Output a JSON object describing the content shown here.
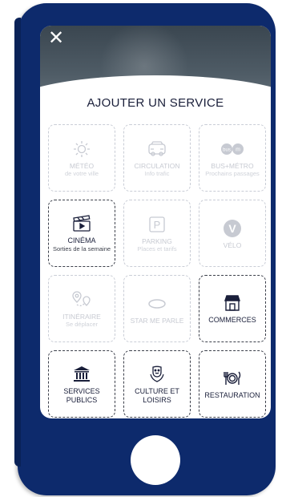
{
  "header": {
    "close_glyph": "✕",
    "title": "AJOUTER UN SERVICE"
  },
  "colors": {
    "phone_frame": "#0d2a6c",
    "active_text": "#1a1f3a",
    "disabled_text": "#c7cad2"
  },
  "services": [
    {
      "label": "MÉTÉO",
      "sub": "de votre ville",
      "icon": "sun-icon",
      "enabled": false
    },
    {
      "label": "CIRCULATION",
      "sub": "Info trafic",
      "icon": "car-icon",
      "enabled": false
    },
    {
      "label": "BUS+MÉTRO",
      "sub": "Prochains passages",
      "icon": "bus-metro-icon",
      "enabled": false
    },
    {
      "label": "CINÉMA",
      "sub": "Sorties de la semaine",
      "icon": "clapperboard-icon",
      "enabled": true
    },
    {
      "label": "PARKING",
      "sub": "Places et tarifs",
      "icon": "parking-icon",
      "enabled": false
    },
    {
      "label": "VÉLO",
      "sub": "",
      "icon": "bike-v-icon",
      "enabled": false
    },
    {
      "label": "ITINÉRAIRE",
      "sub": "Se déplacer",
      "icon": "route-pins-icon",
      "enabled": false
    },
    {
      "label": "STAR ME PARLE",
      "sub": "",
      "icon": "chat-bubble-icon",
      "enabled": false
    },
    {
      "label": "COMMERCES",
      "sub": "",
      "icon": "shop-icon",
      "enabled": true
    },
    {
      "label": "SERVICES PUBLICS",
      "sub": "",
      "icon": "public-building-icon",
      "enabled": true
    },
    {
      "label": "CULTURE ET LOISIRS",
      "sub": "",
      "icon": "theatre-masks-icon",
      "enabled": true
    },
    {
      "label": "RESTAURATION",
      "sub": "",
      "icon": "cutlery-icon",
      "enabled": true
    }
  ]
}
